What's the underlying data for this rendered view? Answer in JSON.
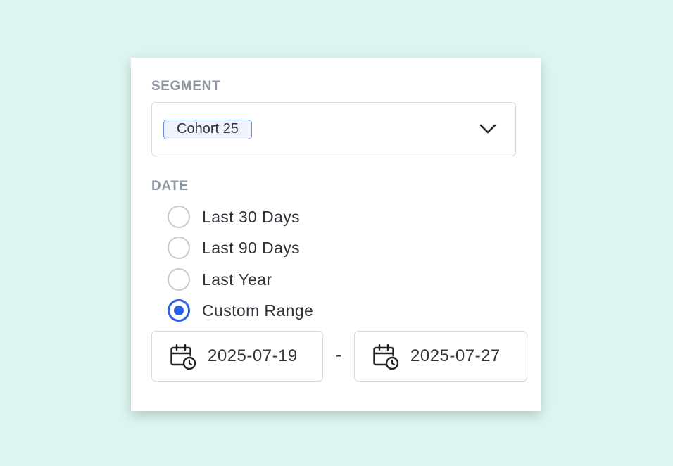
{
  "segment": {
    "label": "SEGMENT",
    "selected_chip": "Cohort 25"
  },
  "date": {
    "label": "DATE",
    "options": [
      {
        "label": "Last 30 Days",
        "checked": false
      },
      {
        "label": "Last 90 Days",
        "checked": false
      },
      {
        "label": "Last Year",
        "checked": false
      },
      {
        "label": "Custom Range",
        "checked": true
      }
    ],
    "range": {
      "start": "2025-07-19",
      "separator": "-",
      "end": "2025-07-27"
    }
  },
  "colors": {
    "background": "#dcf5f0",
    "accent": "#2a5fe6",
    "label": "#8c95a1",
    "chip_border": "#6a8fe0",
    "chip_fill": "#eef3fd"
  },
  "icons": [
    "chevron-down-icon",
    "calendar-clock-icon"
  ]
}
